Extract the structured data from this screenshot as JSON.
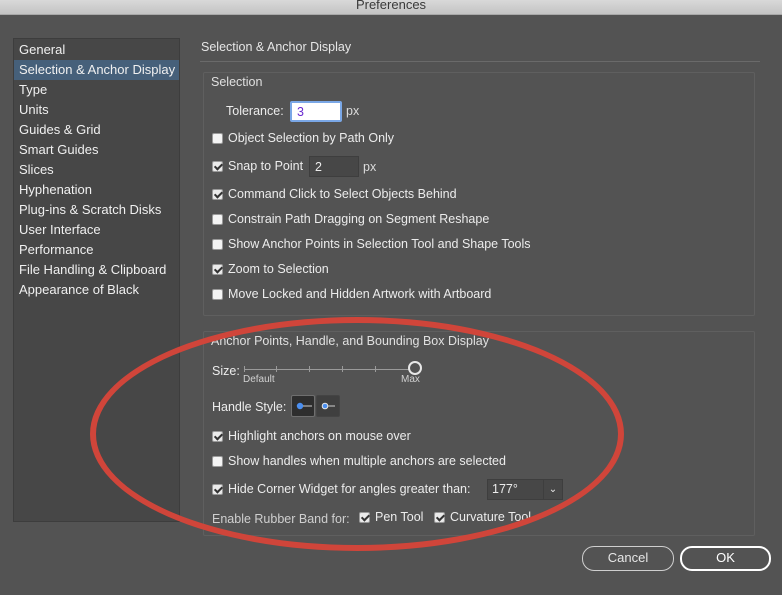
{
  "window": {
    "title": "Preferences"
  },
  "sidebar": {
    "items": [
      {
        "label": "General"
      },
      {
        "label": "Selection & Anchor Display"
      },
      {
        "label": "Type"
      },
      {
        "label": "Units"
      },
      {
        "label": "Guides & Grid"
      },
      {
        "label": "Smart Guides"
      },
      {
        "label": "Slices"
      },
      {
        "label": "Hyphenation"
      },
      {
        "label": "Plug-ins & Scratch Disks"
      },
      {
        "label": "User Interface"
      },
      {
        "label": "Performance"
      },
      {
        "label": "File Handling & Clipboard"
      },
      {
        "label": "Appearance of Black"
      }
    ],
    "selected": "Selection & Anchor Display"
  },
  "main": {
    "section_title": "Selection & Anchor Display",
    "selection": {
      "title": "Selection",
      "tolerance_label": "Tolerance:",
      "tolerance_value": "3",
      "tolerance_unit": "px",
      "object_selection_by_path": {
        "label": "Object Selection by Path Only",
        "checked": false
      },
      "snap_to_point": {
        "label": "Snap to Point",
        "checked": true,
        "value": "2",
        "unit": "px"
      },
      "command_click": {
        "label": "Command Click to Select Objects Behind",
        "checked": true
      },
      "constrain_path": {
        "label": "Constrain Path Dragging on Segment Reshape",
        "checked": false
      },
      "show_anchor_points": {
        "label": "Show Anchor Points in Selection Tool and Shape Tools",
        "checked": false
      },
      "zoom_to_selection": {
        "label": "Zoom to Selection",
        "checked": true
      },
      "move_locked": {
        "label": "Move Locked and Hidden Artwork with Artboard",
        "checked": false
      }
    },
    "anchor": {
      "title": "Anchor Points, Handle, and Bounding Box Display",
      "size_label": "Size:",
      "size_min_label": "Default",
      "size_max_label": "Max",
      "size_level": 1.0,
      "handle_style_label": "Handle Style:",
      "highlight_anchors": {
        "label": "Highlight anchors on mouse over",
        "checked": true
      },
      "show_handles": {
        "label": "Show handles when multiple anchors are selected",
        "checked": false
      },
      "hide_corner_widget": {
        "label": "Hide Corner Widget for angles greater than:",
        "checked": true,
        "value": "177°"
      },
      "rubber_band_label": "Enable Rubber Band for:",
      "pen_tool": {
        "label": "Pen Tool",
        "checked": true
      },
      "curvature_tool": {
        "label": "Curvature Tool",
        "checked": true
      }
    }
  },
  "buttons": {
    "cancel": "Cancel",
    "ok": "OK"
  },
  "colors": {
    "background": "#535353",
    "selected_item": "#46607a",
    "annotation_ellipse": "#d0453a",
    "focus_border": "#7aa7e6"
  }
}
